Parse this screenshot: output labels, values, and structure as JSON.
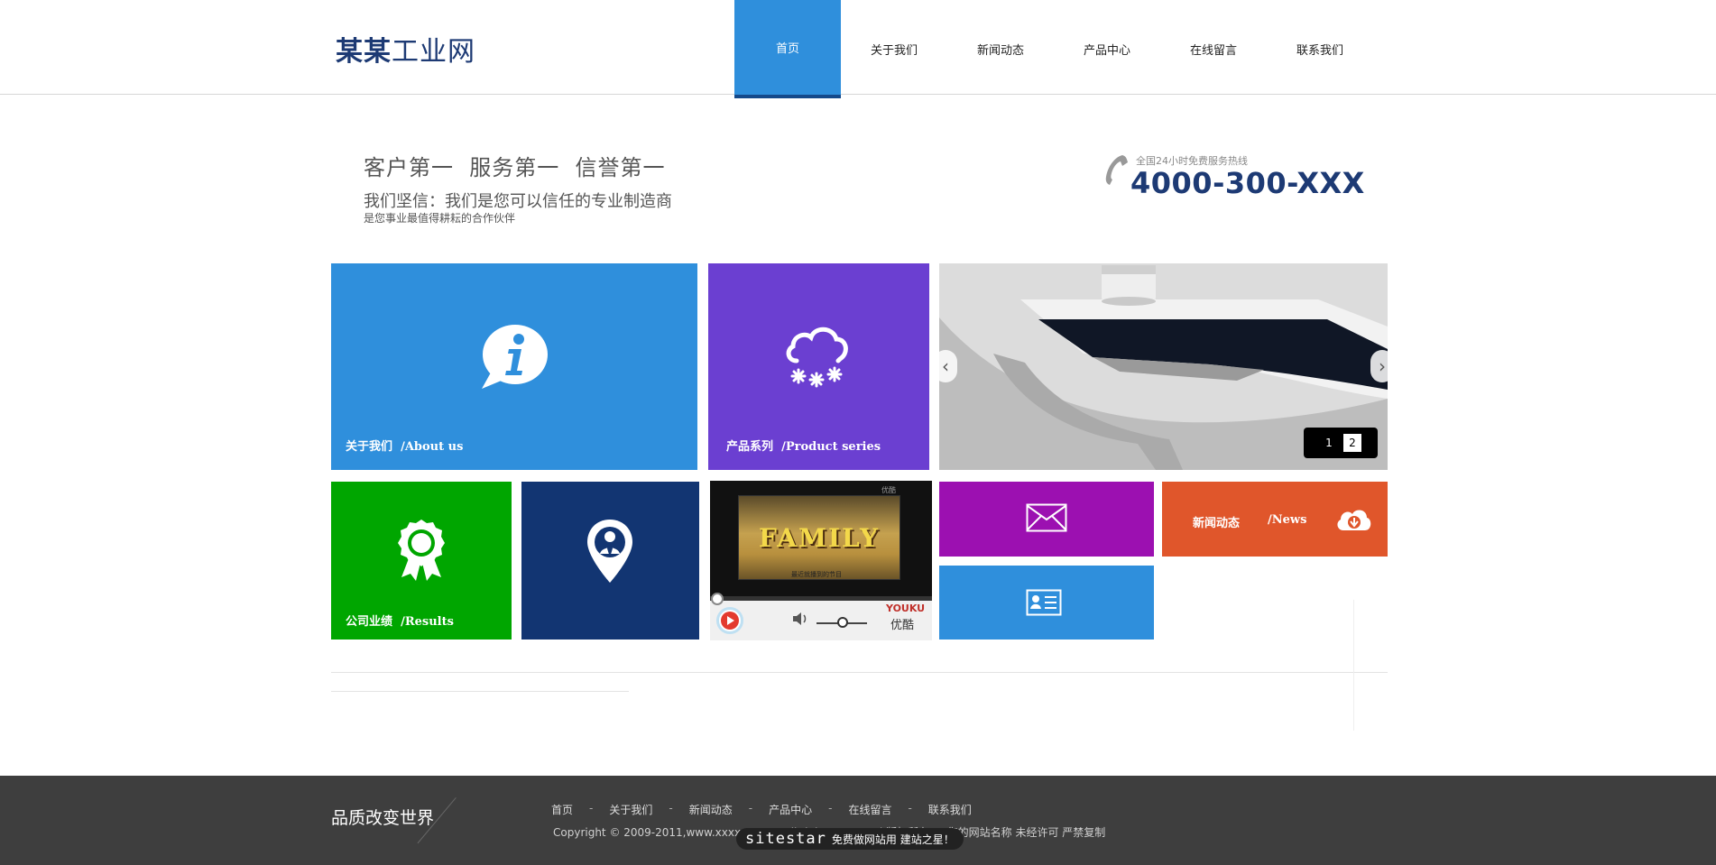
{
  "header": {
    "logo_bold": "某某",
    "logo_thin": "工业网",
    "nav": [
      "首页",
      "关于我们",
      "新闻动态",
      "产品中心",
      "在线留言",
      "联系我们"
    ],
    "active_nav": "首页"
  },
  "banner": {
    "slogan_main": "客户第一  服务第一  信誉第一",
    "slogan_sub": "我们坚信：我们是您可以信任的专业制造商",
    "slogan_small": "是您事业最值得耕耘的合作伙伴",
    "hotline_label": "全国24小时免费服务热线",
    "hotline_number": "4000-300-XXX"
  },
  "tiles": {
    "about": {
      "label": "关于我们",
      "en": "/About us",
      "icon": "info-bubble-icon"
    },
    "product": {
      "label": "产品系列",
      "en": "/Product series",
      "icon": "cloud-snow-icon"
    },
    "results": {
      "label": "公司业绩",
      "en": "/Results",
      "icon": "award-ribbon-icon"
    },
    "map": {
      "icon": "location-person-icon"
    },
    "mail": {
      "icon": "mail-icon"
    },
    "news": {
      "label": "新闻动态",
      "en": "/News",
      "icon": "cloud-download-icon"
    },
    "card": {
      "icon": "contact-card-icon"
    }
  },
  "slider": {
    "pages": [
      "1",
      "2"
    ],
    "active_page": "2"
  },
  "video": {
    "title_text": "FAMILY",
    "subtitle": "最近就播到的节目",
    "source": "优酷",
    "brand_en": "YOUKU",
    "brand_cn": "优酷"
  },
  "footer": {
    "slogan": "品质改变世界",
    "links": [
      "首页",
      "关于我们",
      "新闻动态",
      "产品中心",
      "在线留言",
      "联系我们"
    ],
    "copyright": "Copyright © 2009-2011,www.xxxxxx.com All rights reserved 版权所有 © 您的网站名称 未经许可 严禁复制",
    "badge_brand": "sitestar",
    "badge_text": "免费做网站用 建站之星！"
  },
  "colors": {
    "blue": "#2f8fdc",
    "purple": "#6b3fd1",
    "green": "#00a600",
    "navy": "#123572",
    "magenta": "#9c10b1",
    "orange": "#e0562b",
    "footer": "#3e3e3e"
  }
}
